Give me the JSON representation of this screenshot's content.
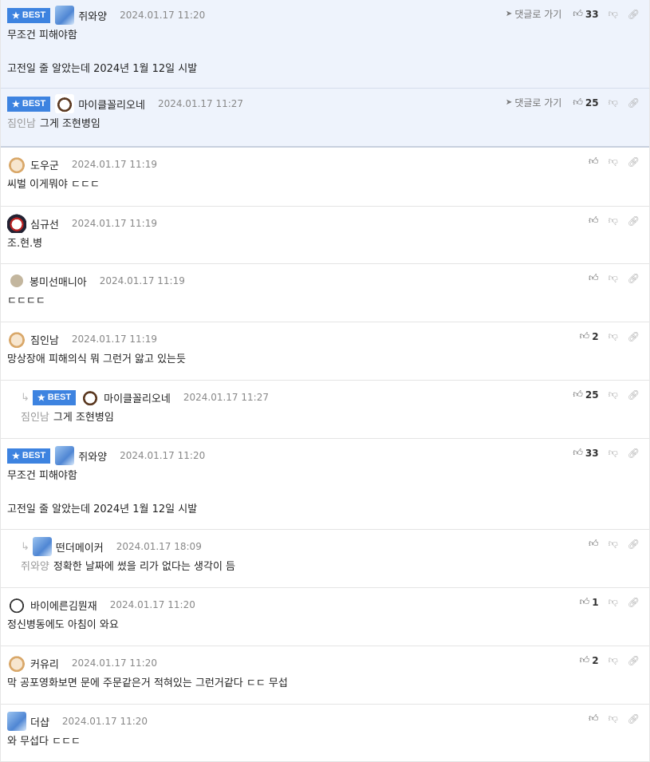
{
  "actions": {
    "goto_label": "댓글로 가기",
    "badge_label": "BEST"
  },
  "comments": [
    {
      "badge": true,
      "avatar": "av-ice",
      "name": "쥐와양",
      "date": "2024.01.17 11:20",
      "tag": "",
      "text": "무조건 피해야함\n\n고전일 줄 알았는데 2024년 1월 12일 시발",
      "likes": "33",
      "goto": true,
      "best_row": true
    },
    {
      "badge": true,
      "avatar": "av-dog",
      "name": "마이클꼴리오네",
      "date": "2024.01.17 11:27",
      "tag": "짐인남",
      "text": "그게 조현병임",
      "likes": "25",
      "goto": true,
      "best_row": true
    },
    {
      "badge": false,
      "avatar": "av-doge",
      "name": "도우군",
      "date": "2024.01.17 11:19",
      "tag": "",
      "text": "씨벌 이게뭐야 ㄷㄷㄷ",
      "likes": ""
    },
    {
      "badge": false,
      "avatar": "av-mask",
      "name": "심규선",
      "date": "2024.01.17 11:19",
      "tag": "",
      "text": "조.현.병",
      "likes": ""
    },
    {
      "badge": false,
      "avatar": "av-dot",
      "name": "봉미선매니아",
      "date": "2024.01.17 11:19",
      "tag": "",
      "text": "ㄷㄷㄷㄷ",
      "likes": ""
    },
    {
      "badge": false,
      "avatar": "av-doge",
      "name": "짐인남",
      "date": "2024.01.17 11:19",
      "tag": "",
      "text": "망상장애 피해의식 뭐 그런거 앓고 있는듯",
      "likes": "2"
    },
    {
      "badge": true,
      "reply": true,
      "avatar": "av-dog",
      "name": "마이클꼴리오네",
      "date": "2024.01.17 11:27",
      "tag": "짐인남",
      "text": "그게 조현병임",
      "likes": "25"
    },
    {
      "badge": true,
      "avatar": "av-ice",
      "name": "쥐와양",
      "date": "2024.01.17 11:20",
      "tag": "",
      "text": "무조건 피해야함\n\n고전일 줄 알았는데 2024년 1월 12일 시발",
      "likes": "33"
    },
    {
      "badge": false,
      "reply": true,
      "avatar": "av-ice",
      "name": "떤더메이커",
      "date": "2024.01.17 18:09",
      "tag": "쥐와양",
      "text": "정확한 날짜에 썼을 리가 없다는 생각이 듬",
      "likes": ""
    },
    {
      "badge": false,
      "avatar": "av-pup",
      "name": "바이에른김뭔재",
      "date": "2024.01.17 11:20",
      "tag": "",
      "text": "정신병동에도 아침이 와요",
      "likes": "1"
    },
    {
      "badge": false,
      "avatar": "av-doge",
      "name": "커유리",
      "date": "2024.01.17 11:20",
      "tag": "",
      "text": "막 공포영화보면 문에 주문같은거 적혀있는 그런거같다 ㄷㄷ 무섭",
      "likes": "2"
    },
    {
      "badge": false,
      "avatar": "av-ice",
      "name": "더샵",
      "date": "2024.01.17 11:20",
      "tag": "",
      "text": "와 무섭다 ㄷㄷㄷ",
      "likes": ""
    }
  ]
}
